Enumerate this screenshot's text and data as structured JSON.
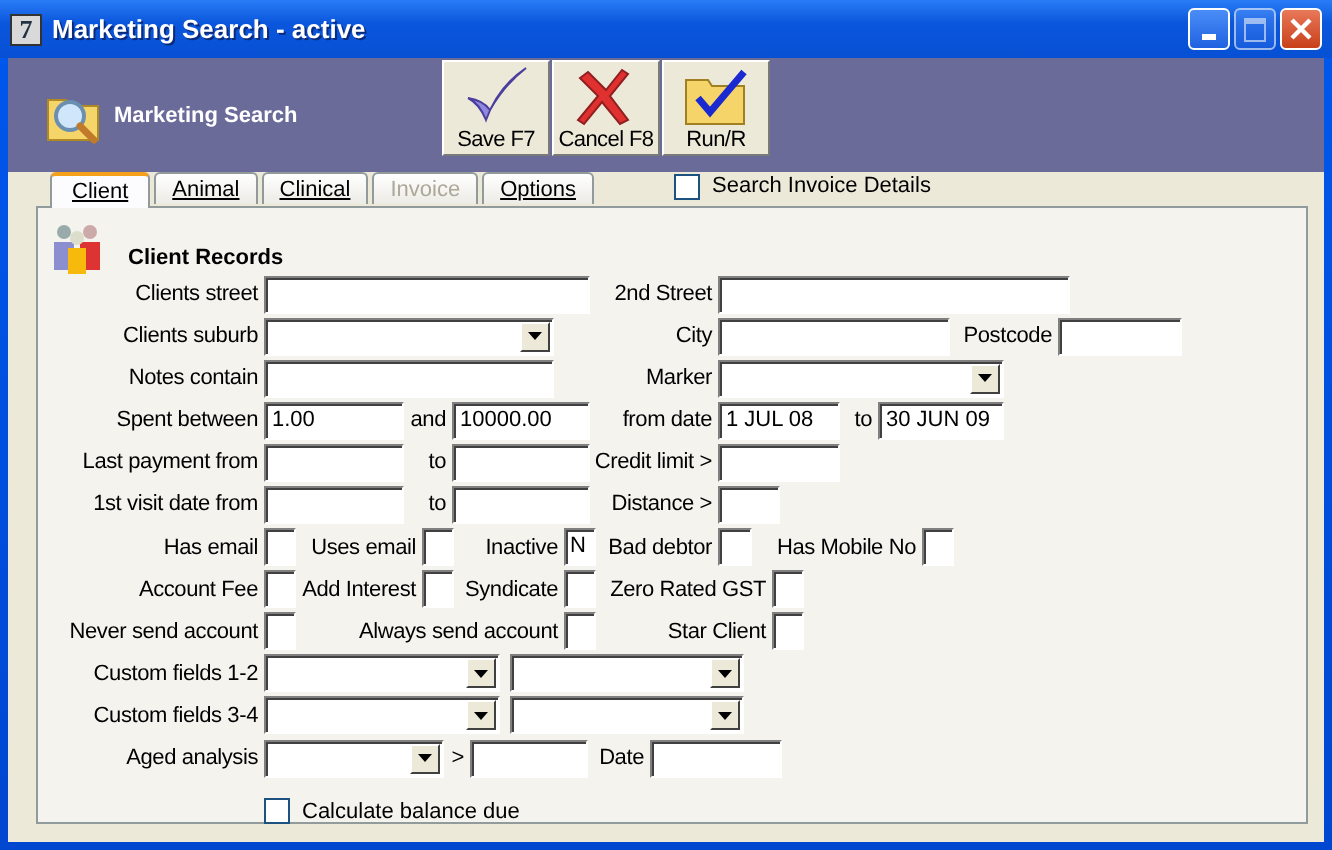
{
  "window": {
    "icon_text": "7",
    "title": "Marketing Search - active"
  },
  "header": {
    "title": "Marketing Search"
  },
  "toolbar": [
    {
      "kind": "save",
      "label": "Save F7"
    },
    {
      "kind": "cancel",
      "label": "Cancel F8"
    },
    {
      "kind": "run",
      "label": "Run/R"
    }
  ],
  "tabs": [
    {
      "label": "Client",
      "selected": true,
      "disabled": false
    },
    {
      "label": "Animal",
      "selected": false,
      "disabled": false
    },
    {
      "label": "Clinical",
      "selected": false,
      "disabled": false
    },
    {
      "label": "Invoice",
      "selected": false,
      "disabled": true
    },
    {
      "label": "Options",
      "selected": false,
      "disabled": false
    }
  ],
  "search_invoice_details": {
    "label": "Search Invoice Details",
    "checked": false
  },
  "section": {
    "title": "Client Records"
  },
  "rows": [
    {
      "items": [
        {
          "kind": "label",
          "text": "Clients street"
        },
        {
          "kind": "field"
        },
        {
          "kind": "label",
          "text": "2nd Street"
        },
        {
          "kind": "field"
        }
      ]
    },
    {
      "items": [
        {
          "kind": "label",
          "text": "Clients suburb"
        },
        {
          "kind": "combo"
        },
        {
          "kind": "label",
          "text": "City"
        },
        {
          "kind": "field"
        },
        {
          "kind": "label",
          "text": "Postcode"
        },
        {
          "kind": "field"
        }
      ]
    },
    {
      "items": [
        {
          "kind": "label",
          "text": "Notes contain"
        },
        {
          "kind": "field"
        },
        {
          "kind": "label",
          "text": "Marker"
        },
        {
          "kind": "combo"
        }
      ]
    },
    {
      "items": [
        {
          "kind": "label",
          "text": "Spent between"
        },
        {
          "kind": "field",
          "value": "1.00"
        },
        {
          "kind": "label",
          "text": "and"
        },
        {
          "kind": "field",
          "value": "10000.00"
        },
        {
          "kind": "label",
          "text": "from date"
        },
        {
          "kind": "field",
          "value": "1 JUL 08"
        },
        {
          "kind": "label",
          "text": "to"
        },
        {
          "kind": "field",
          "value": "30 JUN 09"
        }
      ]
    },
    {
      "items": [
        {
          "kind": "label",
          "text": "Last payment from"
        },
        {
          "kind": "field"
        },
        {
          "kind": "label",
          "text": "to"
        },
        {
          "kind": "field"
        },
        {
          "kind": "label",
          "text": "Credit limit >"
        },
        {
          "kind": "field"
        }
      ]
    },
    {
      "items": [
        {
          "kind": "label",
          "text": "1st visit date from"
        },
        {
          "kind": "field"
        },
        {
          "kind": "label",
          "text": "to"
        },
        {
          "kind": "field"
        },
        {
          "kind": "label",
          "text": "Distance >"
        },
        {
          "kind": "field"
        }
      ]
    },
    {
      "items": [
        {
          "kind": "label",
          "text": "Has email"
        },
        {
          "kind": "flag"
        },
        {
          "kind": "label",
          "text": "Uses email"
        },
        {
          "kind": "flag"
        },
        {
          "kind": "label",
          "text": "Inactive"
        },
        {
          "kind": "flag",
          "value": "N"
        },
        {
          "kind": "label",
          "text": "Bad debtor"
        },
        {
          "kind": "flag"
        },
        {
          "kind": "label",
          "text": "Has Mobile No"
        },
        {
          "kind": "flag"
        }
      ]
    },
    {
      "items": [
        {
          "kind": "label",
          "text": "Account Fee"
        },
        {
          "kind": "flag"
        },
        {
          "kind": "label",
          "text": "Add Interest"
        },
        {
          "kind": "flag"
        },
        {
          "kind": "label",
          "text": "Syndicate"
        },
        {
          "kind": "flag"
        },
        {
          "kind": "label",
          "text": "Zero Rated GST"
        },
        {
          "kind": "flag"
        }
      ]
    },
    {
      "items": [
        {
          "kind": "label",
          "text": "Never send account"
        },
        {
          "kind": "flag"
        },
        {
          "kind": "label",
          "text": "Always send account"
        },
        {
          "kind": "flag"
        },
        {
          "kind": "label",
          "text": "Star Client"
        },
        {
          "kind": "flag"
        }
      ]
    },
    {
      "items": [
        {
          "kind": "label",
          "text": "Custom fields 1-2"
        },
        {
          "kind": "combo"
        },
        {
          "kind": "combo"
        }
      ]
    },
    {
      "items": [
        {
          "kind": "label",
          "text": "Custom fields 3-4"
        },
        {
          "kind": "combo"
        },
        {
          "kind": "combo"
        }
      ]
    },
    {
      "items": [
        {
          "kind": "label",
          "text": "Aged analysis"
        },
        {
          "kind": "combo"
        },
        {
          "kind": "label",
          "text": ">"
        },
        {
          "kind": "field"
        },
        {
          "kind": "label",
          "text": "Date"
        },
        {
          "kind": "field"
        }
      ]
    }
  ],
  "calculate_balance_due": {
    "label": "Calculate balance due",
    "checked": false
  }
}
